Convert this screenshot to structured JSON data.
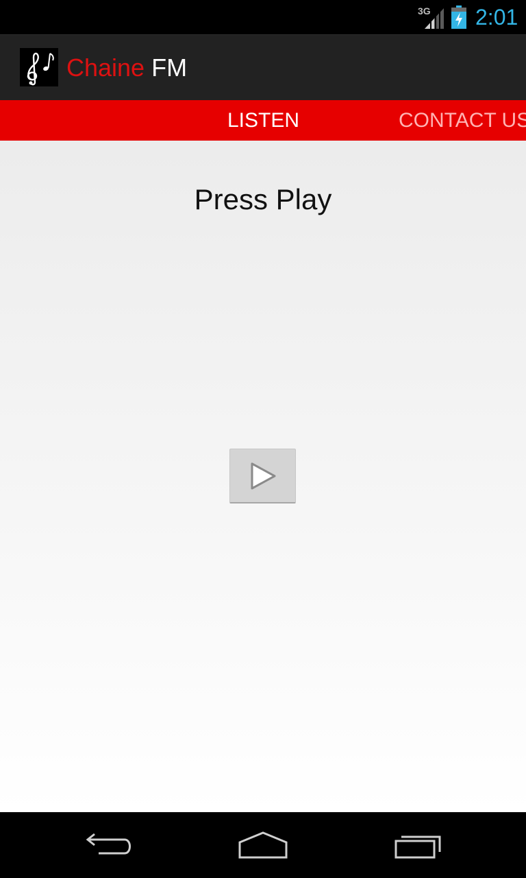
{
  "status_bar": {
    "network": "3G",
    "time": "2:01",
    "icons": [
      "signal-icon",
      "battery-charging-icon"
    ]
  },
  "action_bar": {
    "title_part1": "Chaine",
    "title_part2": "FM",
    "icon": "music-notes-icon"
  },
  "tabs": [
    {
      "label": "LISTEN",
      "selected": true
    },
    {
      "label": "CONTACT US",
      "selected": false
    }
  ],
  "main": {
    "heading": "Press Play",
    "play_button_icon": "play-icon"
  },
  "nav_bar": {
    "icons": [
      "back-icon",
      "home-icon",
      "recent-apps-icon"
    ]
  },
  "colors": {
    "accent_red": "#e60000",
    "title_red": "#dd1111",
    "clock_blue": "#33b5e5",
    "action_bar": "#222222"
  }
}
